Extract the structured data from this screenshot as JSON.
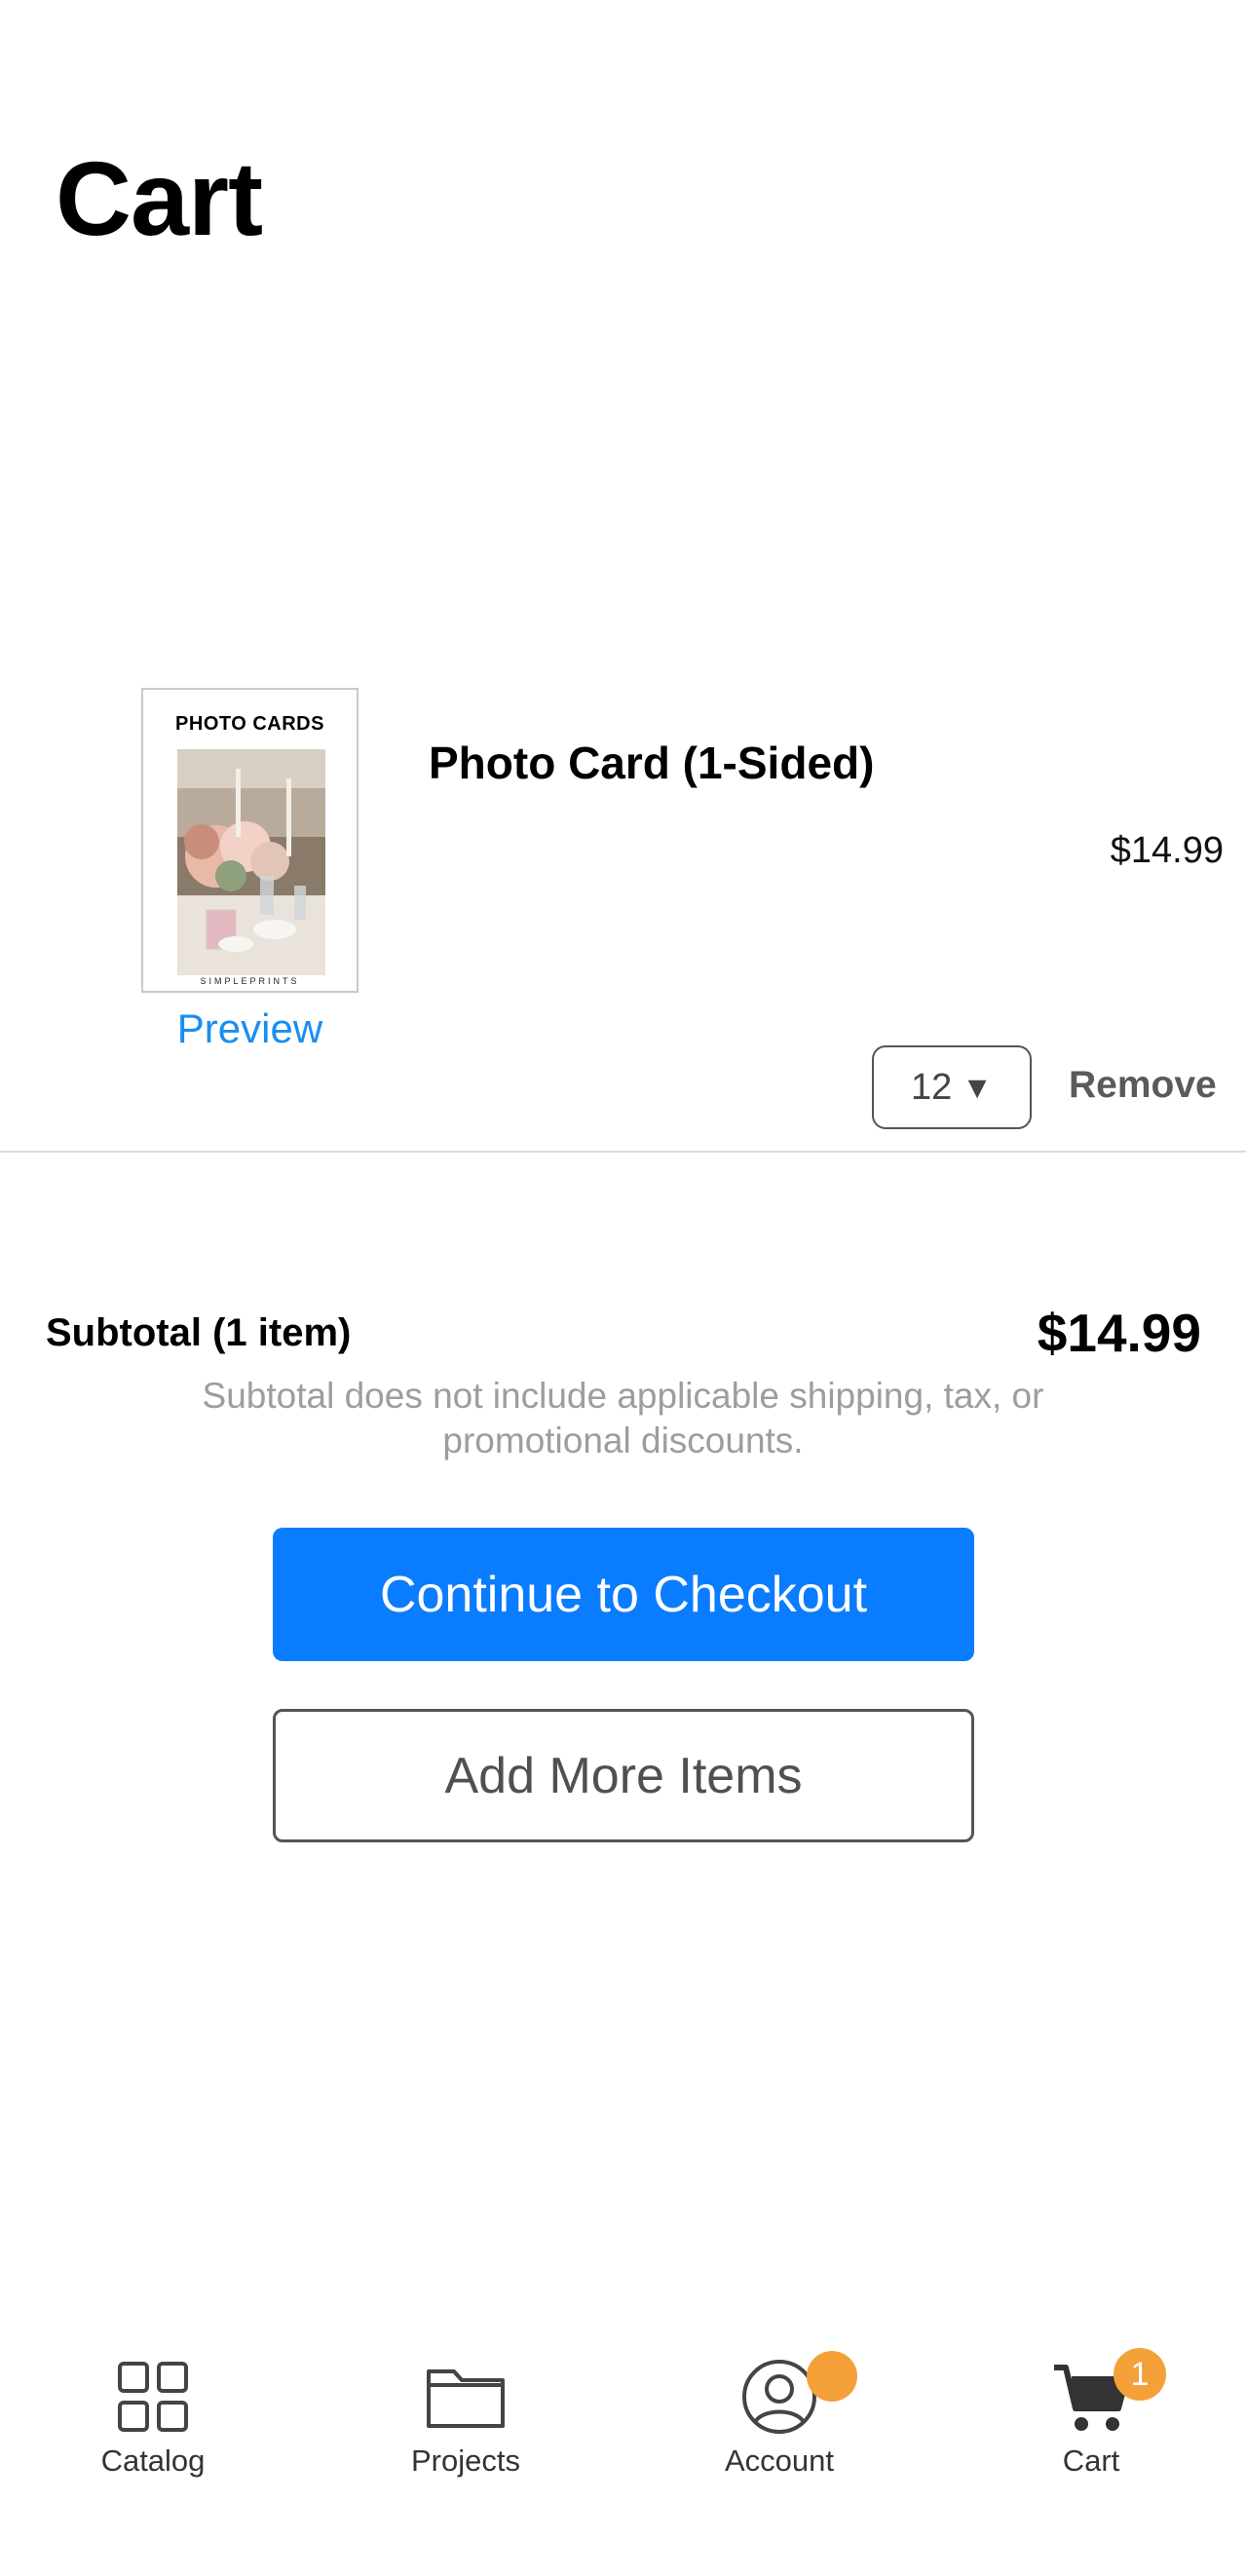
{
  "header": {
    "title": "Cart"
  },
  "cart_item": {
    "thumbnail_heading": "PHOTO CARDS",
    "thumbnail_brand": "SIMPLEPRINTS",
    "preview_label": "Preview",
    "name": "Photo Card (1-Sided)",
    "price": "$14.99",
    "quantity": "12",
    "quantity_arrow": "▼",
    "remove_label": "Remove"
  },
  "summary": {
    "subtotal_label": "Subtotal (1 item)",
    "subtotal_amount": "$14.99",
    "note": "Subtotal does not include applicable shipping, tax, or promotional discounts."
  },
  "actions": {
    "checkout_label": "Continue to Checkout",
    "add_more_label": "Add More Items",
    "primary_color": "#0a7cff"
  },
  "tabbar": {
    "tabs": [
      {
        "label": "Catalog",
        "icon": "grid-icon"
      },
      {
        "label": "Projects",
        "icon": "folder-icon"
      },
      {
        "label": "Account",
        "icon": "user-circle-icon"
      },
      {
        "label": "Cart",
        "icon": "cart-icon",
        "badge": "1"
      }
    ],
    "badge_color": "#f4a13a"
  }
}
